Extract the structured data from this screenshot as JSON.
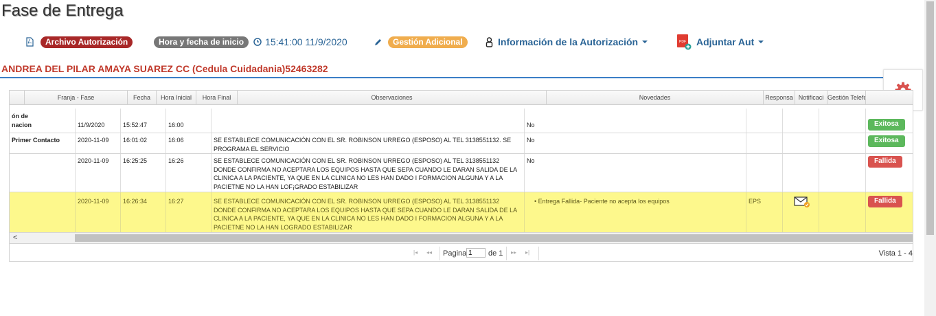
{
  "title": "Fase de Entrega",
  "toolbar": {
    "archivo_label": "Archivo Autorización",
    "hora_label": "Hora y fecha de inicio",
    "hora_value": "15:41:00 11/9/2020",
    "gestion_label": "Gestión Adicional",
    "info_label": "Información de la Autorización",
    "adjuntar_label": "Adjuntar Aut"
  },
  "patient": "ANDREA DEL PILAR AMAYA SUAREZ CC (Cedula Cuidadania)52463282",
  "grid": {
    "columns": [
      "Franja - Fase",
      "Fecha",
      "Hora Inicial",
      "Hora Final",
      "Observaciones",
      "Novedades",
      "Responsa",
      "Notificaci",
      "Gestión Telefo"
    ],
    "rows": [
      {
        "fase": "ón de\nnacion",
        "fecha": "11/9/2020",
        "hora_ini": "15:52:47",
        "hora_fin": "16:00",
        "obs": "",
        "nov": "No",
        "resp": "",
        "estado": "Exitosa"
      },
      {
        "fase": "Primer Contacto",
        "fecha": "2020-11-09",
        "hora_ini": "16:01:02",
        "hora_fin": "16:06",
        "obs": "SE ESTABLECE COMUNICACIÓN CON EL SR. ROBINSON URREGO (ESPOSO) AL TEL 3138551132. SE PROGRAMA EL SERVICIO",
        "nov": "No",
        "resp": "",
        "estado": "Exitosa"
      },
      {
        "fase": "",
        "fecha": "2020-11-09",
        "hora_ini": "16:25:25",
        "hora_fin": "16:26",
        "obs": "SE ESTABLECE COMUNICACIÓN CON EL SR. ROBINSON URREGO (ESPOSO) AL TEL 3138551132 DONDE CONFIRMA NO ACEPTARA LOS EQUIPOS HASTA QUE SEPA CUANDO LE DARAN SALIDA DE LA CLINICA A LA PACIENTE, YA QUE EN LA CLINICA NO LES HAN DADO I FORMACION ALGUNA Y A LA PACIETNE NO LA HAN LOF¡GRADO ESTABILIZAR",
        "nov": "No",
        "resp": "",
        "estado": "Fallida"
      },
      {
        "fase": "",
        "fecha": "2020-11-09",
        "hora_ini": "16:26:34",
        "hora_fin": "16:27",
        "obs": "SE ESTABLECE COMUNICACIÓN CON EL SR. ROBINSON URREGO (ESPOSO) AL TEL 3138551132 DONDE CONFIRMA NO ACEPTARA LOS EQUIPOS HASTA QUE SEPA CUANDO LE DARAN SALIDA DE LA CLINICA A LA PACIENTE, YA QUE EN LA CLINICA NO LES HAN DADO I FORMACION ALGUNA Y A LA PACIETNE NO LA HAN LOGRADO ESTABILIZAR",
        "nov": "Entrega Fallida- Paciente no acepta los equipos",
        "resp": "EPS",
        "estado": "Fallida"
      }
    ]
  },
  "pager": {
    "pagina_label": "Pagina",
    "page_value": "1",
    "de_label": "de 1",
    "vista_label": "Vista 1 - 4"
  },
  "colors": {
    "exitosa": "#5cb85c",
    "fallida": "#d9534f",
    "highlight": "#fdf88c",
    "accent": "#2a6496"
  }
}
